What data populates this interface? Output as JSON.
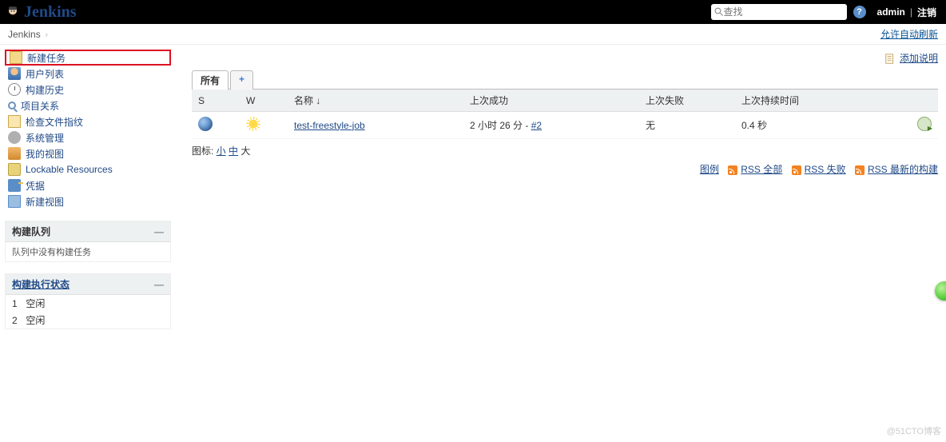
{
  "header": {
    "title": "Jenkins",
    "search_placeholder": "查找",
    "user": "admin",
    "logout": "注销"
  },
  "breadcrumb": {
    "root": "Jenkins",
    "auto_refresh": "允许自动刷新"
  },
  "sidebar": {
    "tasks": [
      {
        "label": "新建任务",
        "highlight": true,
        "icon": "ico-doc",
        "name": "sidebar-new-item"
      },
      {
        "label": "用户列表",
        "icon": "ico-user",
        "name": "sidebar-people"
      },
      {
        "label": "构建历史",
        "icon": "ico-clock",
        "name": "sidebar-build-history"
      },
      {
        "label": "项目关系",
        "icon": "ico-search",
        "name": "sidebar-project-relation"
      },
      {
        "label": "检查文件指纹",
        "icon": "ico-fp",
        "name": "sidebar-check-fingerprint"
      },
      {
        "label": "系统管理",
        "icon": "ico-gear",
        "name": "sidebar-manage"
      },
      {
        "label": "我的视图",
        "icon": "ico-people",
        "name": "sidebar-my-views"
      },
      {
        "label": "Lockable Resources",
        "icon": "ico-lock",
        "name": "sidebar-lockable-resources"
      },
      {
        "label": "凭据",
        "icon": "ico-cred",
        "name": "sidebar-credentials"
      },
      {
        "label": "新建视图",
        "icon": "ico-folder",
        "name": "sidebar-new-view"
      }
    ],
    "queue": {
      "title": "构建队列",
      "empty": "队列中没有构建任务"
    },
    "executor": {
      "title": "构建执行状态",
      "rows": [
        {
          "num": "1",
          "state": "空闲"
        },
        {
          "num": "2",
          "state": "空闲"
        }
      ]
    }
  },
  "main": {
    "add_description": "添加说明",
    "tabs": {
      "active": "所有",
      "plus": "+"
    },
    "columns": {
      "s": "S",
      "w": "W",
      "name": "名称 ↓",
      "last_success": "上次成功",
      "last_failure": "上次失败",
      "last_duration": "上次持续时间"
    },
    "jobs": [
      {
        "name": "test-freestyle-job",
        "last_success_text": "2 小时 26 分 - ",
        "last_success_build": "#2",
        "last_failure": "无",
        "last_duration": "0.4 秒"
      }
    ],
    "icon_legend_prefix": "图标: ",
    "icon_small": "小",
    "icon_medium": "中",
    "icon_large": " 大",
    "legend": "图例",
    "rss_all": "RSS 全部",
    "rss_fail": "RSS 失败",
    "rss_latest": "RSS 最新的构建"
  },
  "watermark": "@51CTO博客"
}
